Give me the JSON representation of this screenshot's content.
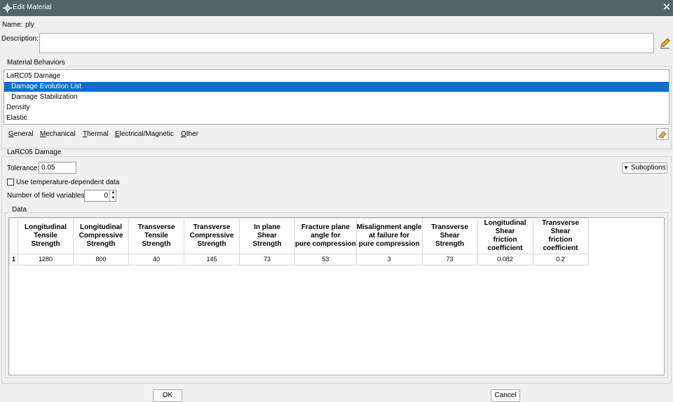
{
  "window": {
    "title": "Edit Material",
    "close_glyph": "✕"
  },
  "name": {
    "label": "Name:",
    "value": "ply"
  },
  "description": {
    "label": "Description:",
    "value": ""
  },
  "behaviors": {
    "title": "Material Behaviors",
    "items": [
      {
        "label": "LaRC05 Damage",
        "indent": false,
        "selected": false
      },
      {
        "label": "Damage Evolution List",
        "indent": true,
        "selected": true
      },
      {
        "label": "Damage Stabilization",
        "indent": true,
        "selected": false
      },
      {
        "label": "Density",
        "indent": false,
        "selected": false
      },
      {
        "label": "Elastic",
        "indent": false,
        "selected": false
      }
    ]
  },
  "menu": [
    {
      "first": "G",
      "rest": "eneral"
    },
    {
      "first": "M",
      "rest": "echanical"
    },
    {
      "first": "T",
      "rest": "hermal"
    },
    {
      "first": "E",
      "rest": "lectrical/Magnetic"
    },
    {
      "first": "O",
      "rest": "ther"
    }
  ],
  "section": {
    "title": "LaRC05 Damage",
    "tolerance_label": "Tolerance:",
    "tolerance_value": "0.05",
    "suboptions_label": "Suboptions",
    "temp_dependent_label": "Use temperature-dependent data",
    "temp_dependent_checked": false,
    "field_vars_label": "Number of field variables:",
    "field_vars_value": "0"
  },
  "data": {
    "title": "Data",
    "columns": [
      [
        "Longitudinal",
        "Tensile",
        "Strength"
      ],
      [
        "Longitudinal",
        "Compressive",
        "Strength"
      ],
      [
        "Transverse",
        "Tensile",
        "Strength"
      ],
      [
        "Transverse",
        "Compressive",
        "Strength"
      ],
      [
        "In plane",
        "Shear",
        "Strength"
      ],
      [
        "Fracture plane",
        "angle for",
        "pure compression"
      ],
      [
        "Misalignment angle",
        "at failure for",
        "pure compression"
      ],
      [
        "Transverse",
        "Shear",
        "Strength"
      ],
      [
        "Longitudinal",
        "Shear",
        "friction",
        "coefficient"
      ],
      [
        "Transverse",
        "Shear",
        "friction",
        "coefficient"
      ]
    ],
    "rows": [
      {
        "index": "1",
        "values": [
          "1280",
          "800",
          "40",
          "145",
          "73",
          "53",
          "3",
          "73",
          "0.082",
          "0.2"
        ]
      }
    ]
  },
  "buttons": {
    "ok": "OK",
    "cancel": "Cancel"
  },
  "colors": {
    "titlebar": "#536564",
    "selection": "#0b6fd1"
  }
}
